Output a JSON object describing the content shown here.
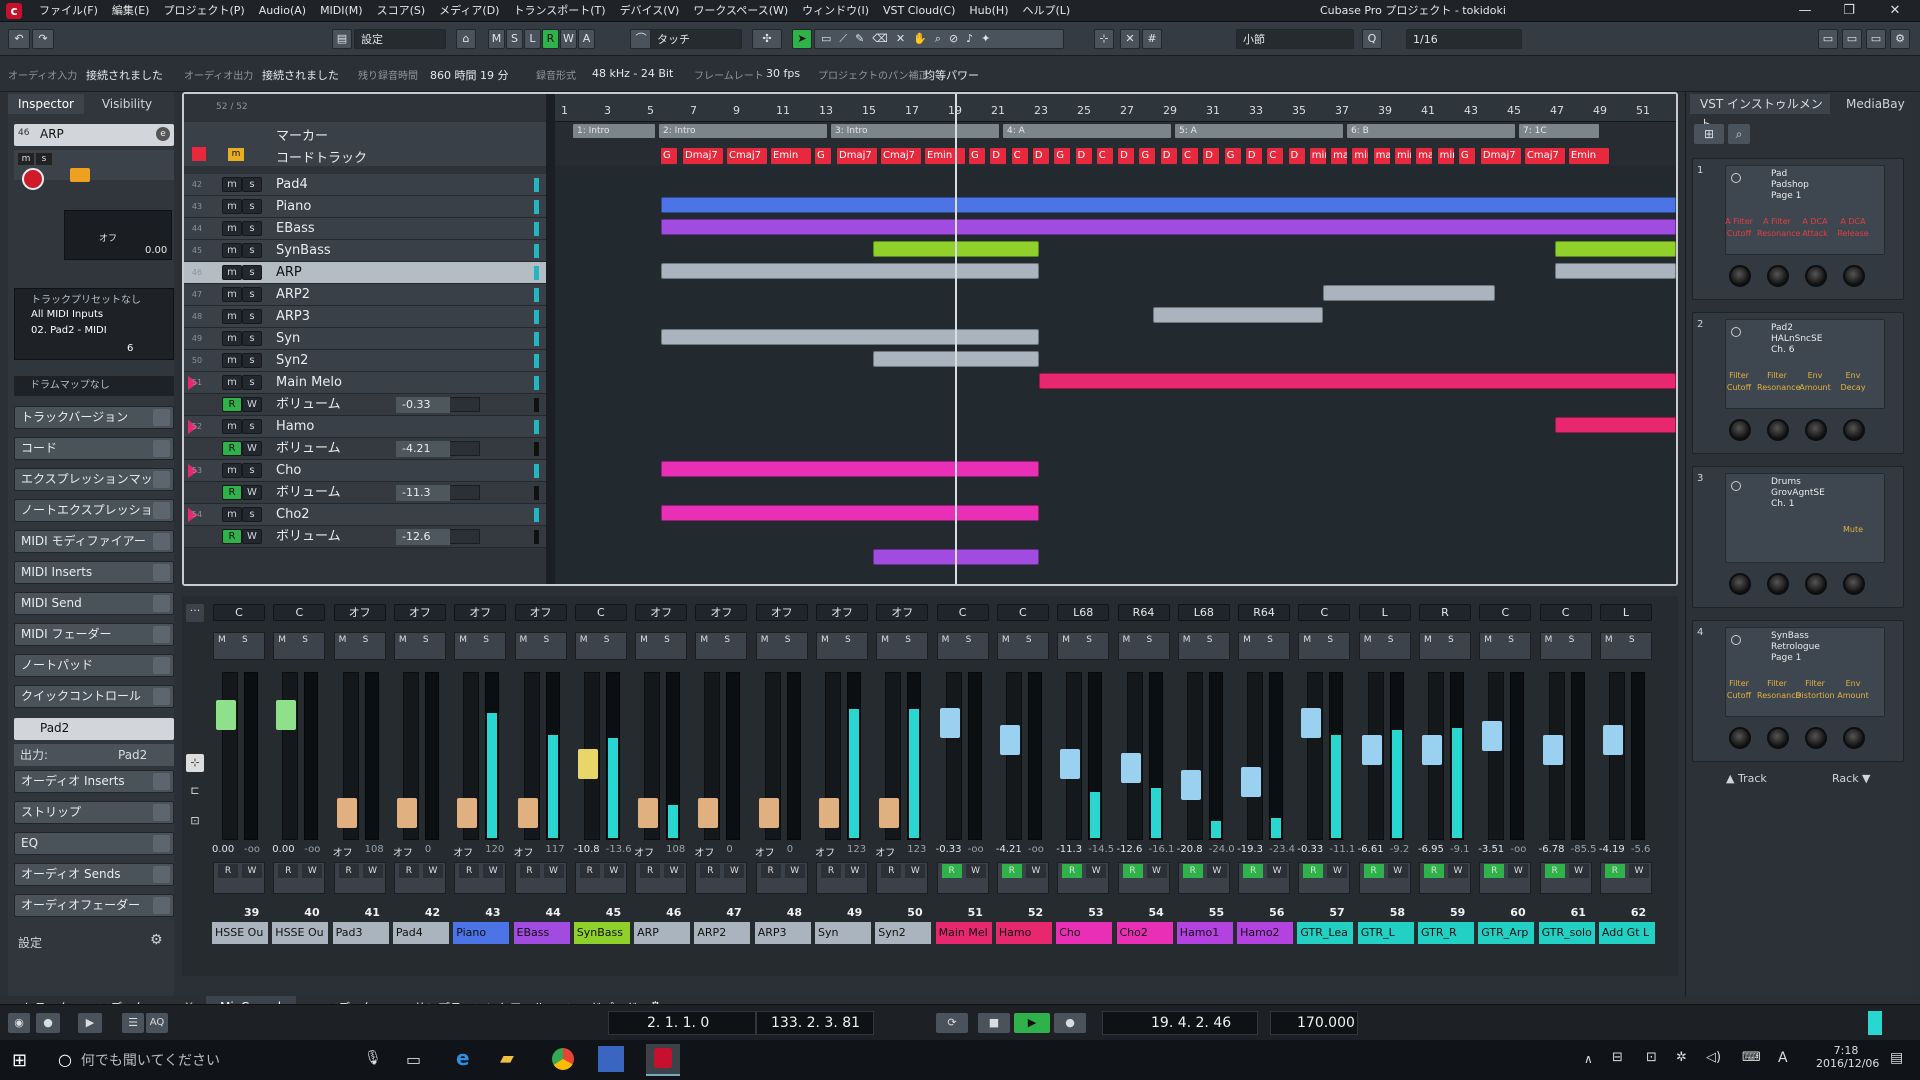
{
  "app": {
    "title": "Cubase Pro プロジェクト - tokidoki",
    "menus": [
      "ファイル(F)",
      "編集(E)",
      "プロジェクト(P)",
      "Audio(A)",
      "MIDI(M)",
      "スコア(S)",
      "メディア(D)",
      "トランスポート(T)",
      "デバイス(V)",
      "ワークスペース(W)",
      "ウィンドウ(I)",
      "VST Cloud(C)",
      "Hub(H)",
      "ヘルプ(L)"
    ],
    "window_controls": {
      "minimize": "—",
      "restore": "❐",
      "close": "✕"
    }
  },
  "toolbar": {
    "setting": "設定",
    "ms_buttons": [
      "M",
      "S",
      "L",
      "R",
      "W",
      "A"
    ],
    "touch_mode": "タッチ",
    "grid_type": "小節",
    "quantize": "1/16",
    "q_label": "Q"
  },
  "info_line": {
    "audio_in_label": "オーディオ入力",
    "audio_in_value": "接続されました",
    "audio_out_label": "オーディオ出力",
    "audio_out_value": "接続されました",
    "rec_time_label": "残り録音時間",
    "rec_time_value": "860 時間 19 分",
    "rec_format_label": "録音形式",
    "rec_format_value": "48 kHz - 24 Bit",
    "frame_rate_label": "フレームレート",
    "frame_rate_value": "30 fps",
    "pan_law_label": "プロジェクトのパン補正",
    "pan_law_value": "均等パワー"
  },
  "inspector": {
    "tabs": [
      "Inspector",
      "Visibility"
    ],
    "track_number": "46",
    "track_name": "ARP",
    "offset_label": "オフ",
    "volume_value": "0.00",
    "preset_none": "トラックプリセットなし",
    "input_routing": "All MIDI Inputs",
    "output_routing": "02. Pad2 - MIDI",
    "channel": "6",
    "drum_map": "ドラムマップなし",
    "sections": [
      "トラックバージョン",
      "コード",
      "エクスプレッションマップ",
      "ノートエクスプレッション",
      "MIDI モディファイアー",
      "MIDI Inserts",
      "MIDI Send",
      "MIDI フェーダー",
      "ノートパッド",
      "クイックコントロール"
    ],
    "instrument_name": "Pad2",
    "instrument_output": "出力:",
    "instrument_output_value": "Pad2",
    "instrument_sections": [
      "オーディオ Inserts",
      "ストリップ",
      "EQ",
      "オーディオ Sends",
      "オーディオフェーダー"
    ],
    "settings_label": "設定"
  },
  "arrange": {
    "track_count": "52 / 52",
    "marker_track": "マーカー",
    "chord_track": "コードトラック",
    "ruler": [
      "1",
      "3",
      "5",
      "7",
      "9",
      "11",
      "13",
      "15",
      "17",
      "19",
      "21",
      "23",
      "25",
      "27",
      "29",
      "31",
      "33",
      "35",
      "37",
      "39",
      "41",
      "43",
      "45",
      "47",
      "49",
      "51"
    ],
    "markers": [
      "1: Intro",
      "2: Intro",
      "3: Intro",
      "4: A",
      "5: A",
      "6: B",
      "7: 1C"
    ],
    "chords": [
      "G",
      "Dmaj7",
      "Cmaj7",
      "Emin",
      "G",
      "Dmaj7",
      "Cmaj7",
      "Emin",
      "G",
      "D",
      "C",
      "D",
      "G",
      "D",
      "C",
      "D",
      "G",
      "D",
      "C",
      "D",
      "G",
      "D",
      "C",
      "D",
      "min",
      "maj",
      "min",
      "maj",
      "min",
      "maj",
      "min",
      "G",
      "Dmaj7",
      "Cmaj7",
      "Emin"
    ],
    "tracks": [
      {
        "num": "42",
        "name": "Pad4",
        "type": "midi"
      },
      {
        "num": "43",
        "name": "Piano",
        "type": "midi"
      },
      {
        "num": "44",
        "name": "EBass",
        "type": "midi"
      },
      {
        "num": "45",
        "name": "SynBass",
        "type": "midi"
      },
      {
        "num": "46",
        "name": "ARP",
        "type": "midi",
        "selected": true
      },
      {
        "num": "47",
        "name": "ARP2",
        "type": "midi"
      },
      {
        "num": "48",
        "name": "ARP3",
        "type": "midi"
      },
      {
        "num": "49",
        "name": "Syn",
        "type": "midi"
      },
      {
        "num": "50",
        "name": "Syn2",
        "type": "midi"
      },
      {
        "num": "51",
        "name": "Main Melo",
        "type": "inst"
      },
      {
        "num": "",
        "name": "ボリューム",
        "type": "auto",
        "value": "-0.33"
      },
      {
        "num": "52",
        "name": "Hamo",
        "type": "inst"
      },
      {
        "num": "",
        "name": "ボリューム",
        "type": "auto",
        "value": "-4.21"
      },
      {
        "num": "53",
        "name": "Cho",
        "type": "inst"
      },
      {
        "num": "",
        "name": "ボリューム",
        "type": "auto",
        "value": "-11.3"
      },
      {
        "num": "54",
        "name": "Cho2",
        "type": "inst"
      },
      {
        "num": "",
        "name": "ボリューム",
        "type": "auto",
        "value": "-12.6"
      }
    ]
  },
  "vst_rack": {
    "tabs": [
      "VST インストゥルメント",
      "MediaBay"
    ],
    "slots": [
      {
        "n": "1",
        "name": "Pad\nPadshop\nPage 1",
        "labels": [
          "A Filter",
          "A Filter",
          "A DCA",
          "A DCA"
        ],
        "sub": [
          "Cutoff",
          "Resonance",
          "Attack",
          "Release"
        ]
      },
      {
        "n": "2",
        "name": "Pad2\nHALnSncSE\nCh. 6",
        "labels": [
          "Filter",
          "Filter",
          "Env",
          "Env"
        ],
        "sub": [
          "Cutoff",
          "Resonance",
          "Amount",
          "Decay"
        ]
      },
      {
        "n": "3",
        "name": "Drums\nGrovAgntSE\nCh. 1",
        "labels": [
          "",
          "",
          "",
          "Mute"
        ],
        "sub": [
          "",
          "",
          "",
          ""
        ]
      },
      {
        "n": "4",
        "name": "SynBass\nRetrologue\nPage 1",
        "labels": [
          "Filter",
          "Filter",
          "Filter",
          "Env"
        ],
        "sub": [
          "Cutoff",
          "Resonance",
          "Distortion",
          "Amount"
        ]
      }
    ],
    "footer_track": "Track",
    "footer_rack": "Rack"
  },
  "mixer": {
    "strips": [
      {
        "idx": "39",
        "name": "HSSE Ou",
        "pan": "C",
        "vol": "0.00",
        "peak": "-oo",
        "color": "#aab4bf",
        "meter": 0,
        "cap": 0.8
      },
      {
        "idx": "40",
        "name": "HSSE Ou",
        "pan": "C",
        "vol": "0.00",
        "peak": "-oo",
        "color": "#aab4bf",
        "meter": 0,
        "cap": 0.8
      },
      {
        "idx": "41",
        "name": "Pad3",
        "pan": "オフ",
        "vol": "オフ",
        "peak": "108",
        "color": "#aab4bf",
        "meter": 0,
        "cap": 0.1
      },
      {
        "idx": "42",
        "name": "Pad4",
        "pan": "オフ",
        "vol": "オフ",
        "peak": "0",
        "color": "#aab4bf",
        "meter": 0,
        "cap": 0.1
      },
      {
        "idx": "43",
        "name": "Piano",
        "pan": "オフ",
        "vol": "オフ",
        "peak": "120",
        "color": "#4d74e6",
        "meter": 0.75,
        "cap": 0.1
      },
      {
        "idx": "44",
        "name": "EBass",
        "pan": "オフ",
        "vol": "オフ",
        "peak": "117",
        "color": "#a24be0",
        "meter": 0.62,
        "cap": 0.1
      },
      {
        "idx": "45",
        "name": "SynBass",
        "pan": "C",
        "vol": "-10.8",
        "peak": "-13.6",
        "color": "#8fd12a",
        "meter": 0.6,
        "cap": 0.45
      },
      {
        "idx": "46",
        "name": "ARP",
        "pan": "オフ",
        "vol": "オフ",
        "peak": "108",
        "color": "#aab4bf",
        "meter": 0.2,
        "cap": 0.1
      },
      {
        "idx": "47",
        "name": "ARP2",
        "pan": "オフ",
        "vol": "オフ",
        "peak": "0",
        "color": "#aab4bf",
        "meter": 0,
        "cap": 0.1
      },
      {
        "idx": "48",
        "name": "ARP3",
        "pan": "オフ",
        "vol": "オフ",
        "peak": "0",
        "color": "#aab4bf",
        "meter": 0,
        "cap": 0.1
      },
      {
        "idx": "49",
        "name": "Syn",
        "pan": "オフ",
        "vol": "オフ",
        "peak": "123",
        "color": "#aab4bf",
        "meter": 0.78,
        "cap": 0.1
      },
      {
        "idx": "50",
        "name": "Syn2",
        "pan": "オフ",
        "vol": "オフ",
        "peak": "123",
        "color": "#aab4bf",
        "meter": 0.78,
        "cap": 0.1
      },
      {
        "idx": "51",
        "name": "Main Mel",
        "pan": "C",
        "vol": "-0.33",
        "peak": "-oo",
        "color": "#e8286e",
        "meter": 0,
        "cap": 0.74
      },
      {
        "idx": "52",
        "name": "Hamo",
        "pan": "C",
        "vol": "-4.21",
        "peak": "-oo",
        "color": "#e8286e",
        "meter": 0,
        "cap": 0.62
      },
      {
        "idx": "53",
        "name": "Cho",
        "pan": "L68",
        "vol": "-11.3",
        "peak": "-14.5",
        "color": "#e82fb5",
        "meter": 0.28,
        "cap": 0.45
      },
      {
        "idx": "54",
        "name": "Cho2",
        "pan": "R64",
        "vol": "-12.6",
        "peak": "-16.1",
        "color": "#e82fb5",
        "meter": 0.3,
        "cap": 0.42
      },
      {
        "idx": "55",
        "name": "Hamo1",
        "pan": "L68",
        "vol": "-20.8",
        "peak": "-24.0",
        "color": "#b342e0",
        "meter": 0.1,
        "cap": 0.3
      },
      {
        "idx": "56",
        "name": "Hamo2",
        "pan": "R64",
        "vol": "-19.3",
        "peak": "-23.4",
        "color": "#b342e0",
        "meter": 0.12,
        "cap": 0.32
      },
      {
        "idx": "57",
        "name": "GTR_Lea",
        "pan": "C",
        "vol": "-0.33",
        "peak": "-11.1",
        "color": "#22d0c4",
        "meter": 0.62,
        "cap": 0.74
      },
      {
        "idx": "58",
        "name": "GTR_L",
        "pan": "L",
        "vol": "-6.61",
        "peak": "-9.2",
        "color": "#22d0c4",
        "meter": 0.65,
        "cap": 0.55
      },
      {
        "idx": "59",
        "name": "GTR_R",
        "pan": "R",
        "vol": "-6.95",
        "peak": "-9.1",
        "color": "#22d0c4",
        "meter": 0.66,
        "cap": 0.55
      },
      {
        "idx": "60",
        "name": "GTR_Arp",
        "pan": "C",
        "vol": "-3.51",
        "peak": "-oo",
        "color": "#22d0c4",
        "meter": 0,
        "cap": 0.65
      },
      {
        "idx": "61",
        "name": "GTR_solo",
        "pan": "C",
        "vol": "-6.78",
        "peak": "-85.5",
        "color": "#22d0c4",
        "meter": 0,
        "cap": 0.55
      },
      {
        "idx": "62",
        "name": "Add Gt L",
        "pan": "L",
        "vol": "-4.19",
        "peak": "-5.6",
        "color": "#22d0c4",
        "meter": 0,
        "cap": 0.62
      }
    ]
  },
  "bottom_tabs": {
    "left": [
      "トラック",
      "エディター"
    ],
    "lower": [
      "MixConsole",
      "エディター",
      "サンプラーコントロール",
      "コードパッド"
    ]
  },
  "transport": {
    "left_locator": "2. 1. 1.   0",
    "right_locator": "133. 2. 3.  81",
    "position": "19.  4.  2.  46",
    "tempo": "170.000",
    "aq": "AQ"
  },
  "taskbar": {
    "search_placeholder": "何でも聞いてください",
    "time": "7:18",
    "date": "2016/12/06",
    "ime": "A"
  },
  "colors": {
    "midi_blue": "#4d74e6",
    "purple": "#a24be0",
    "green": "#8fd12a",
    "grey": "#aab4bf",
    "pink": "#e8286e",
    "magenta": "#e82fb5",
    "chord_red": "#e8283c"
  }
}
